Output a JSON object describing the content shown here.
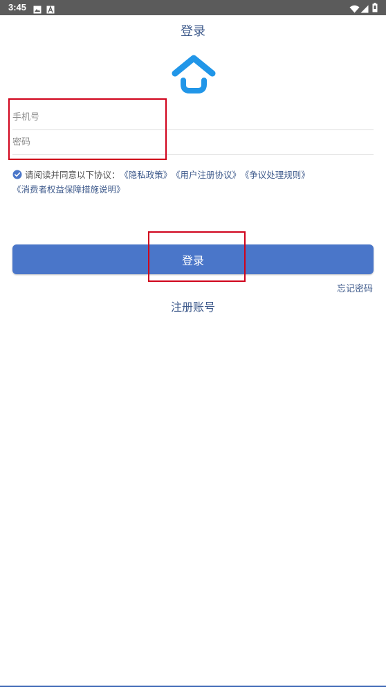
{
  "status_bar": {
    "time": "3:45",
    "icons": [
      "image-icon",
      "text-a-icon",
      "wifi-icon",
      "signal-icon",
      "battery-icon"
    ]
  },
  "header": {
    "title": "登录"
  },
  "logo": {
    "icon": "house-smile-icon",
    "color": "#2196e8"
  },
  "form": {
    "phone_placeholder": "手机号",
    "password_placeholder": "密码",
    "phone_value": "",
    "password_value": ""
  },
  "agreement": {
    "checked": true,
    "prefix": "请阅读并同意以下协议：",
    "links": [
      "《隐私政策》",
      "《用户注册协议》",
      "《争议处理规则》",
      "《消费者权益保障措施说明》"
    ]
  },
  "actions": {
    "login_label": "登录",
    "forgot_password": "忘记密码",
    "register": "注册账号"
  },
  "colors": {
    "accent": "#4a76c9",
    "link": "#3f5b8c",
    "annotation": "#d0021b"
  }
}
